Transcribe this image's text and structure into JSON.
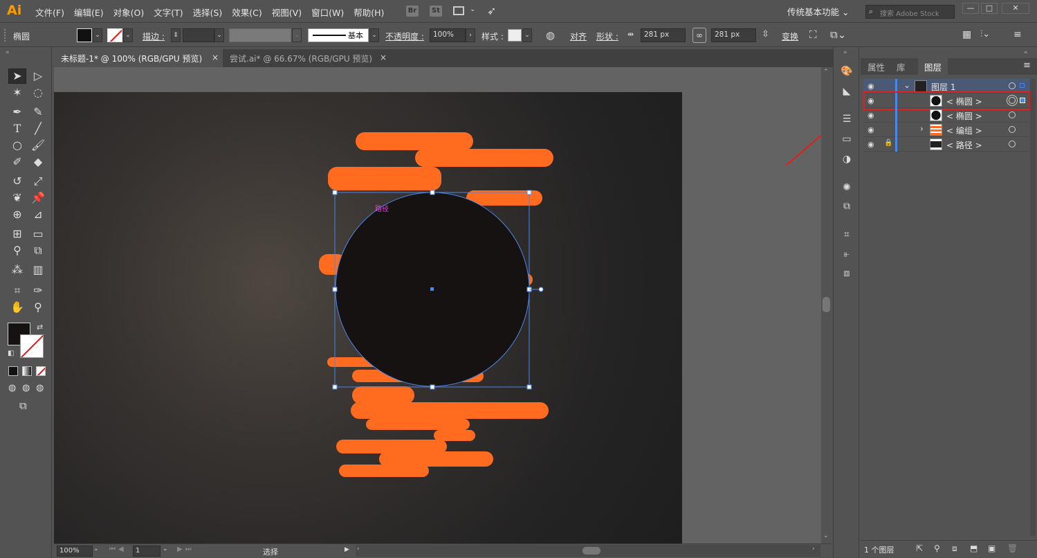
{
  "app": {
    "logo": "Ai",
    "workspace": "传统基本功能",
    "search_placeholder": "搜索 Adobe Stock"
  },
  "menu": [
    "文件(F)",
    "编辑(E)",
    "对象(O)",
    "文字(T)",
    "选择(S)",
    "效果(C)",
    "视图(V)",
    "窗口(W)",
    "帮助(H)"
  ],
  "menu_buttons": {
    "br": "Br",
    "st": "St"
  },
  "window_controls": {
    "minimize": "—",
    "maximize": "□",
    "close": "✕"
  },
  "control_bar": {
    "object_type": "椭圆",
    "stroke_label": "描边 :",
    "stroke_profile": "基本",
    "opacity_label": "不透明度 :",
    "opacity_value": "100%",
    "style_label": "样式 :",
    "align_label": "对齐",
    "shape_label": "形状 :",
    "width_value": "281 px",
    "height_value": "281 px",
    "transform_label": "变换"
  },
  "tabs": [
    {
      "title": "未标题-1* @ 100% (RGB/GPU 预览)",
      "close": "×",
      "active": true
    },
    {
      "title": "尝试.ai* @ 66.67% (RGB/GPU 预览)",
      "close": "×",
      "active": false
    }
  ],
  "canvas": {
    "path_label": "路径",
    "accent": "#ff6b1f",
    "circle_fill": "#161211",
    "selection_color": "#4b87e6"
  },
  "status": {
    "zoom": "100%",
    "page": "1",
    "tool": "选择"
  },
  "panel": {
    "tabs": [
      "属性",
      "库",
      "图层"
    ],
    "active_tab": "图层",
    "layers": [
      {
        "name": "图层 1",
        "eye": "◉",
        "lock": "",
        "expand": "⌄",
        "selected": true
      },
      {
        "name": "< 椭圆 >",
        "eye": "◉",
        "lock": "",
        "expand": "",
        "selected": false,
        "highlighted": true
      },
      {
        "name": "< 椭圆 >",
        "eye": "◉",
        "lock": "",
        "expand": "",
        "selected": false
      },
      {
        "name": "< 编组 >",
        "eye": "◉",
        "lock": "",
        "expand": "›",
        "selected": false
      },
      {
        "name": "< 路径 >",
        "eye": "◉",
        "lock": "🔒",
        "expand": "",
        "selected": false
      }
    ],
    "footer_count": "1 个图层"
  },
  "colors": {
    "highlight_box": "#e0201c",
    "arrow": "#e0201c",
    "layer_selected_bg": "#4a5a75",
    "ai_orange": "#ff9a00"
  }
}
